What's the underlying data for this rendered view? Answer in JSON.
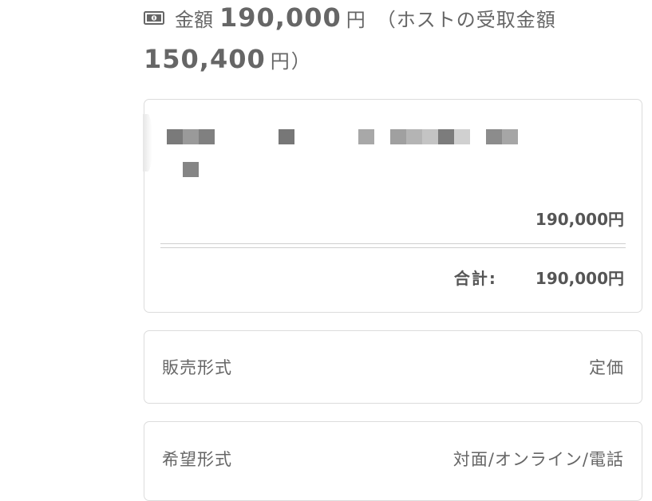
{
  "price_header": {
    "icon": "money-icon",
    "label": "金額",
    "amount": "190,000",
    "unit": "円",
    "host_receive_label": "（ホストの受取金額",
    "host_amount": "150,400",
    "host_unit": "円",
    "close_paren": "）"
  },
  "order": {
    "item_name_redacted": true,
    "subtotal": "190,000円",
    "total_label": "合計:",
    "total": "190,000円"
  },
  "details": [
    {
      "label": "販売形式",
      "value": "定価"
    },
    {
      "label": "希望形式",
      "value": "対面/オンライン/電話"
    }
  ],
  "colors": {
    "text": "#666666",
    "border": "#dcdcdc"
  }
}
